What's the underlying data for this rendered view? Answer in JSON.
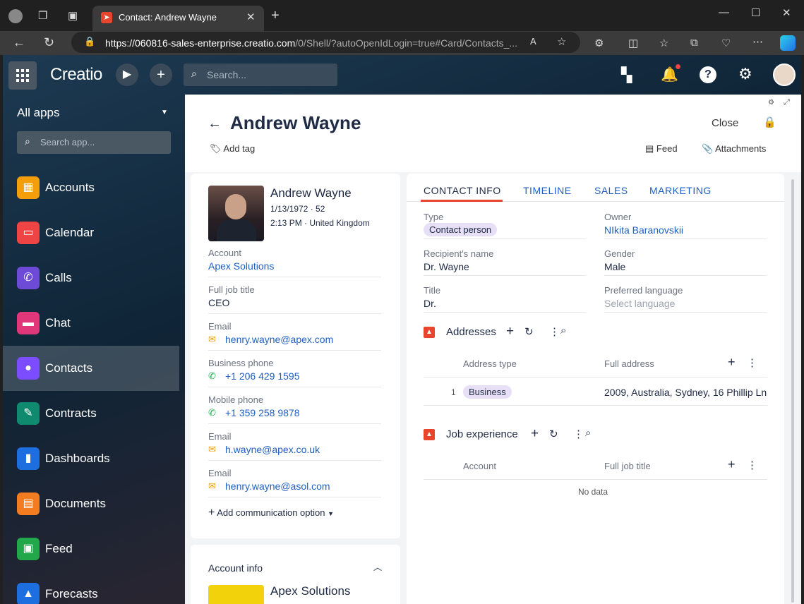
{
  "browser": {
    "tab_title": "Contact: Andrew Wayne",
    "url_host": "https://060816-sales-enterprise.creatio.com",
    "url_path": "/0/Shell/?autoOpenIdLogin=true#Card/Contacts_..."
  },
  "topnav": {
    "logo": "Creatio",
    "search_placeholder": "Search..."
  },
  "sidebar": {
    "all_apps": "All apps",
    "search_placeholder": "Search app...",
    "items": [
      {
        "label": "Accounts",
        "color": "#f59e0b",
        "icon": "accounts-icon"
      },
      {
        "label": "Calendar",
        "color": "#ef4444",
        "icon": "calendar-icon"
      },
      {
        "label": "Calls",
        "color": "#6d4bd6",
        "icon": "phone-icon"
      },
      {
        "label": "Chat",
        "color": "#e0367a",
        "icon": "chat-icon"
      },
      {
        "label": "Contacts",
        "color": "#7c4dff",
        "icon": "contacts-icon"
      },
      {
        "label": "Contracts",
        "color": "#0f8a6f",
        "icon": "contracts-icon"
      },
      {
        "label": "Dashboards",
        "color": "#1d6fe0",
        "icon": "dashboards-icon"
      },
      {
        "label": "Documents",
        "color": "#f47c20",
        "icon": "documents-icon"
      },
      {
        "label": "Feed",
        "color": "#22a84a",
        "icon": "feed-icon"
      },
      {
        "label": "Forecasts",
        "color": "#1d6fe0",
        "icon": "forecasts-icon"
      }
    ]
  },
  "header": {
    "title": "Andrew Wayne",
    "add_tag": "Add tag",
    "close": "Close",
    "feed": "Feed",
    "attachments": "Attachments"
  },
  "profile": {
    "name": "Andrew Wayne",
    "birth": "1/13/1972 · 52",
    "time_location": "2:13 PM · United Kingdom",
    "fields": [
      {
        "label": "Account",
        "value": "Apex Solutions",
        "link": true
      },
      {
        "label": "Full job title",
        "value": "CEO",
        "link": false
      },
      {
        "label": "Email",
        "value": "henry.wayne@apex.com",
        "link": true,
        "icon": "email-icon"
      },
      {
        "label": "Business phone",
        "value": "+1 206 429 1595",
        "link": true,
        "icon": "phone-icon"
      },
      {
        "label": "Mobile phone",
        "value": "+1 359 258 9878",
        "link": true,
        "icon": "phone-icon"
      },
      {
        "label": "Email",
        "value": "h.wayne@apex.co.uk",
        "link": true,
        "icon": "email-icon"
      },
      {
        "label": "Email",
        "value": "henry.wayne@asol.com",
        "link": true,
        "icon": "email-icon"
      }
    ],
    "add_comm": "Add communication option"
  },
  "account_info": {
    "title": "Account info",
    "name": "Apex Solutions"
  },
  "tabs": [
    "CONTACT INFO",
    "TIMELINE",
    "SALES",
    "MARKETING"
  ],
  "contact_info": {
    "type_label": "Type",
    "type_value": "Contact person",
    "owner_label": "Owner",
    "owner_value": "NIkita Baranovskii",
    "recipient_label": "Recipient's name",
    "recipient_value": "Dr. Wayne",
    "gender_label": "Gender",
    "gender_value": "Male",
    "title_label": "Title",
    "title_value": "Dr.",
    "language_label": "Preferred language",
    "language_placeholder": "Select language"
  },
  "addresses": {
    "title": "Addresses",
    "col_type": "Address type",
    "col_full": "Full address",
    "rows": [
      {
        "num": "1",
        "type": "Business",
        "full": "2009, Australia, Sydney, 16 Phillip Ln"
      }
    ]
  },
  "job_experience": {
    "title": "Job experience",
    "col_account": "Account",
    "col_title": "Full job title",
    "empty": "No data"
  }
}
